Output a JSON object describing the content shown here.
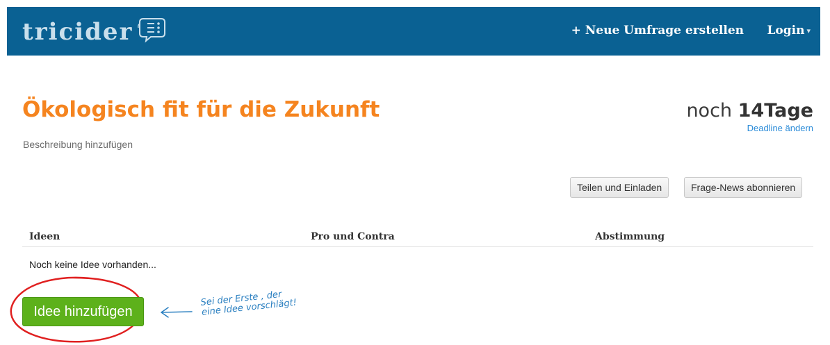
{
  "navbar": {
    "logo_text": "tricider",
    "new_poll_label": "+ Neue Umfrage erstellen",
    "login_label": "Login",
    "background_color": "#0a6193"
  },
  "question": {
    "title": "Ökologisch fit für die Zukunft",
    "description_link": "Beschreibung hinzufügen",
    "title_color": "#f5841f"
  },
  "deadline": {
    "prefix": "noch",
    "number": "14",
    "unit": "Tage",
    "change_link": "Deadline ändern"
  },
  "actions": {
    "share_label": "Teilen und Einladen",
    "subscribe_label": "Frage-News abonnieren"
  },
  "table": {
    "columns": [
      "Ideen",
      "Pro und Contra",
      "Abstimmung"
    ],
    "empty_message": "Noch keine Idee vorhanden..."
  },
  "add_idea": {
    "button_label": "Idee hinzufügen",
    "button_color": "#5db11b"
  },
  "annotation": {
    "hint_line1": "Sei der Erste , der",
    "hint_line2": "eine Idee vorschlägt!",
    "circle_color": "#e02020",
    "arrow_color": "#2a7fc0"
  }
}
